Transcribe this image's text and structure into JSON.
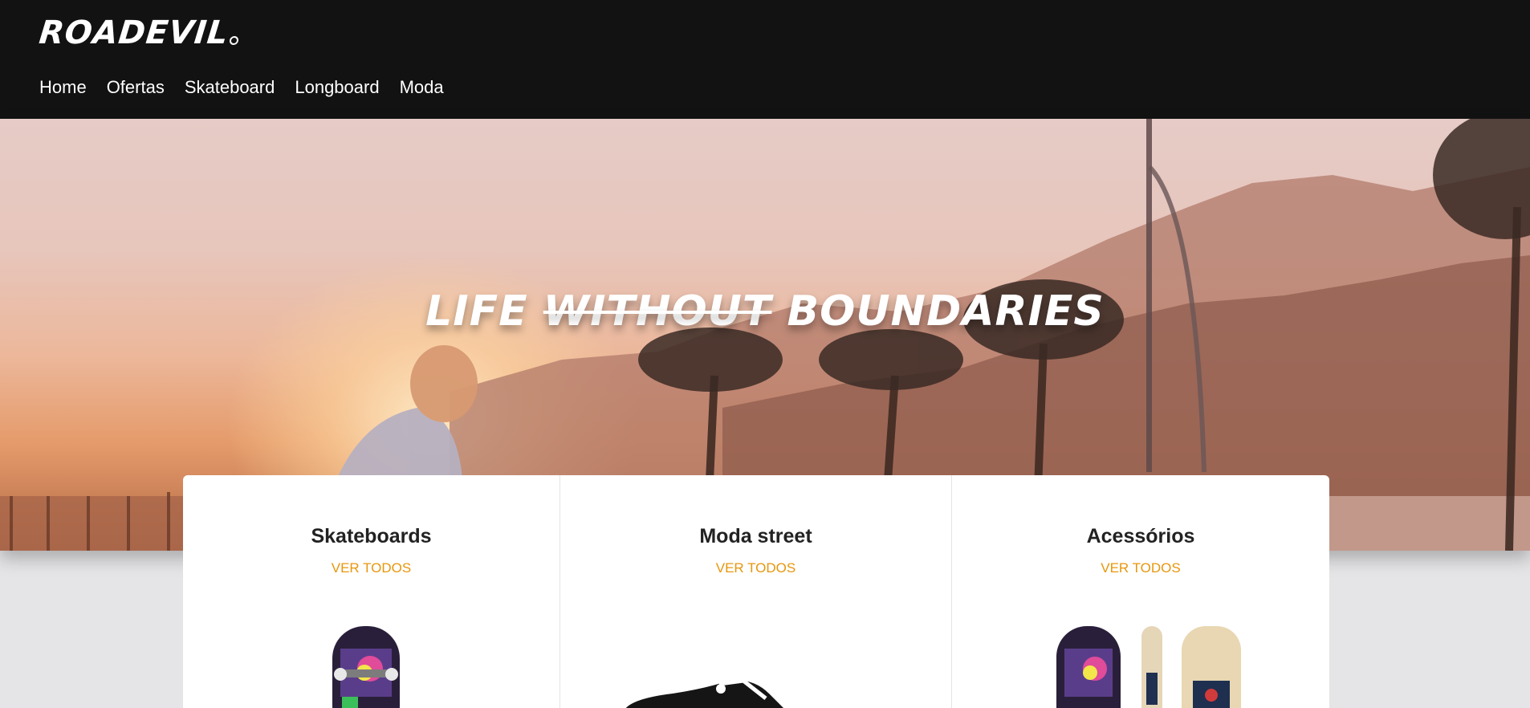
{
  "brand": {
    "logo": "ROADEVIL"
  },
  "nav": {
    "items": [
      {
        "label": "Home"
      },
      {
        "label": "Ofertas"
      },
      {
        "label": "Skateboard"
      },
      {
        "label": "Longboard"
      },
      {
        "label": "Moda"
      }
    ]
  },
  "hero": {
    "headline_part1": "LIFE ",
    "headline_strike": "WITHOUT",
    "headline_part2": " BOUNDARIES"
  },
  "categories": [
    {
      "title": "Skateboards",
      "link": "VER TODOS"
    },
    {
      "title": "Moda street",
      "link": "VER TODOS"
    },
    {
      "title": "Acessórios",
      "link": "VER TODOS"
    }
  ],
  "colors": {
    "header_bg": "#121212",
    "accent": "#e8960c",
    "page_bg": "#e5e5e7"
  }
}
